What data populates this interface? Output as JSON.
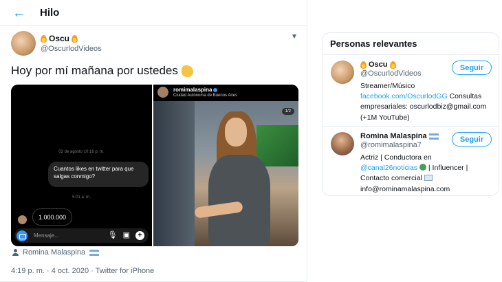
{
  "header": {
    "title": "Hilo",
    "back_icon": "arrow-left-icon"
  },
  "tweet": {
    "author_name": "Oscu",
    "author_handle": "@OscurlodVideos",
    "text": "Hoy por mí mañana por ustedes",
    "text_emoji": "clapping-hands-icon",
    "tagged_user": "Romina Malaspina",
    "timestamp": "4:19 p. m. · 4 oct. 2020 · Twitter for iPhone"
  },
  "chat_screenshot": {
    "date": "02 de agosto 10:16 p. m.",
    "question": "Cuantos likes en twitter para que salgas conmigo?",
    "time": "5:01 a. m.",
    "answer": "1.000.000",
    "composer_placeholder": "Mensaje..."
  },
  "instagram": {
    "username": "romimalaspina",
    "location": "Ciudad Autónoma de Buenos Aires",
    "counter": "1/2"
  },
  "sidebar": {
    "title": "Personas relevantes",
    "people": [
      {
        "name": "Oscu",
        "handle": "@OscurlodVideos",
        "follow_label": "Seguir",
        "bio_1": "Streamer/Músico",
        "bio_link": "facebook.com/OscurlodGG",
        "bio_2": "Consultas empresariales: oscurlodbiz@gmail.com (+1M YouTube)"
      },
      {
        "name": "Romina Malaspina",
        "handle": "@romimalaspina7",
        "follow_label": "Seguir",
        "bio_1": "Actriz | Conductora en",
        "bio_link": "@canal26noticias",
        "bio_2": "| Influencer | Contacto comercial",
        "bio_3": "info@rominamalaspina.com"
      }
    ]
  },
  "colors": {
    "accent": "#1da1f2",
    "muted_text": "#536471",
    "border": "#e6ecf0"
  }
}
